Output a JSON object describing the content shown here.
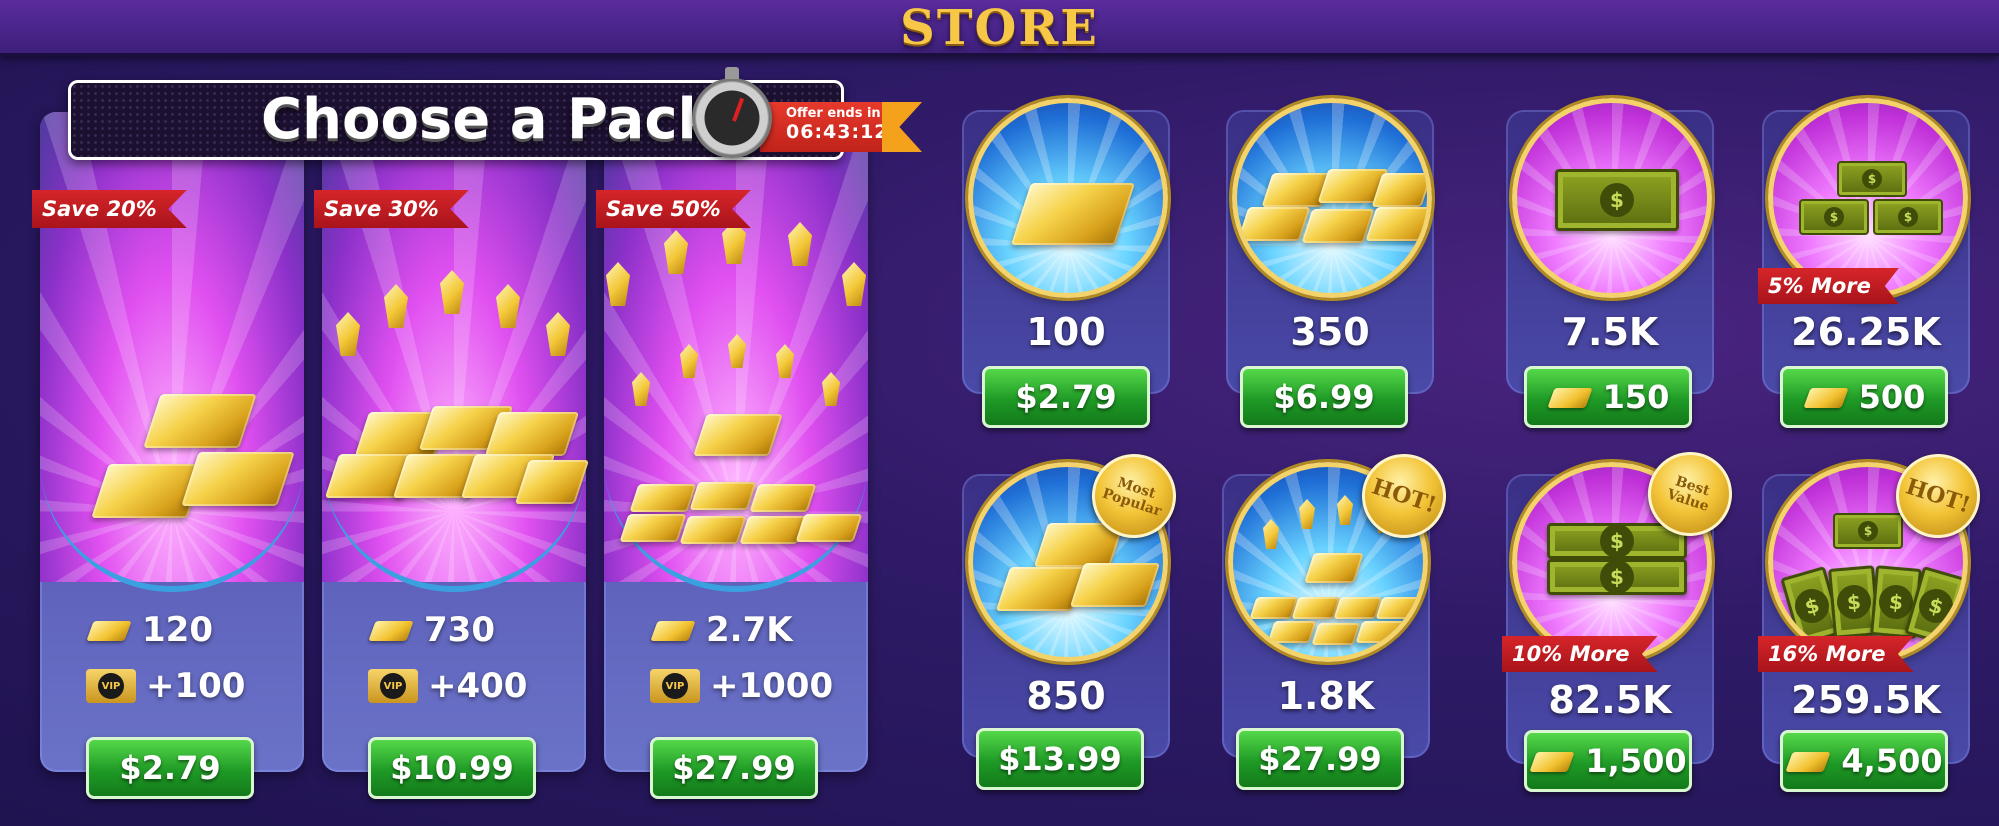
{
  "header": {
    "title": "STORE"
  },
  "pack_banner": {
    "title": "Choose a Pack",
    "offer_label": "Offer ends in",
    "offer_time": "06:43:12"
  },
  "big_packs": [
    {
      "save": "Save 20%",
      "gold": "120",
      "vip": "+100",
      "price": "$2.79"
    },
    {
      "save": "Save 30%",
      "gold": "730",
      "vip": "+400",
      "price": "$10.99"
    },
    {
      "save": "Save 50%",
      "gold": "2.7K",
      "vip": "+1000",
      "price": "$27.99"
    }
  ],
  "vip_label": "VIP",
  "gold_packs": [
    {
      "amount": "100",
      "price": "$2.79"
    },
    {
      "amount": "350",
      "price": "$6.99"
    },
    {
      "amount": "850",
      "price": "$13.99",
      "badge": "Most Popular"
    },
    {
      "amount": "1.8K",
      "price": "$27.99",
      "badge": "HOT!"
    }
  ],
  "cash_packs": [
    {
      "amount": "7.5K",
      "cost": "150"
    },
    {
      "amount": "26.25K",
      "cost": "500",
      "ribbon": "5% More"
    },
    {
      "amount": "82.5K",
      "cost": "1,500",
      "ribbon": "10% More",
      "badge": "Best Value"
    },
    {
      "amount": "259.5K",
      "cost": "4,500",
      "ribbon": "16% More",
      "badge": "HOT!"
    }
  ],
  "dollar_glyph": "$"
}
